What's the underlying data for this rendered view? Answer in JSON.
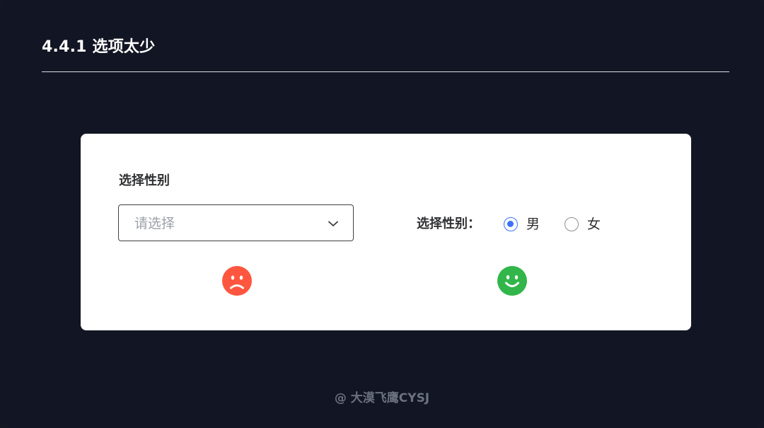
{
  "header": {
    "title": "4.4.1 选项太少"
  },
  "left_example": {
    "label": "选择性别",
    "select": {
      "placeholder": "请选择",
      "icon": "chevron-down-icon"
    },
    "feedback_icon": "sad-face-icon",
    "feedback_color": "#ff563f"
  },
  "right_example": {
    "label": "选择性别：",
    "options": [
      {
        "label": "男",
        "checked": true
      },
      {
        "label": "女",
        "checked": false
      }
    ],
    "feedback_icon": "happy-face-icon",
    "feedback_color": "#32b64a"
  },
  "footer": {
    "watermark": "@ 大漠飞鹰CYSJ"
  },
  "colors": {
    "background": "#121624",
    "card": "#ffffff",
    "selected_radio": "#3d72f6",
    "unselected_radio": "#8c8f96"
  }
}
